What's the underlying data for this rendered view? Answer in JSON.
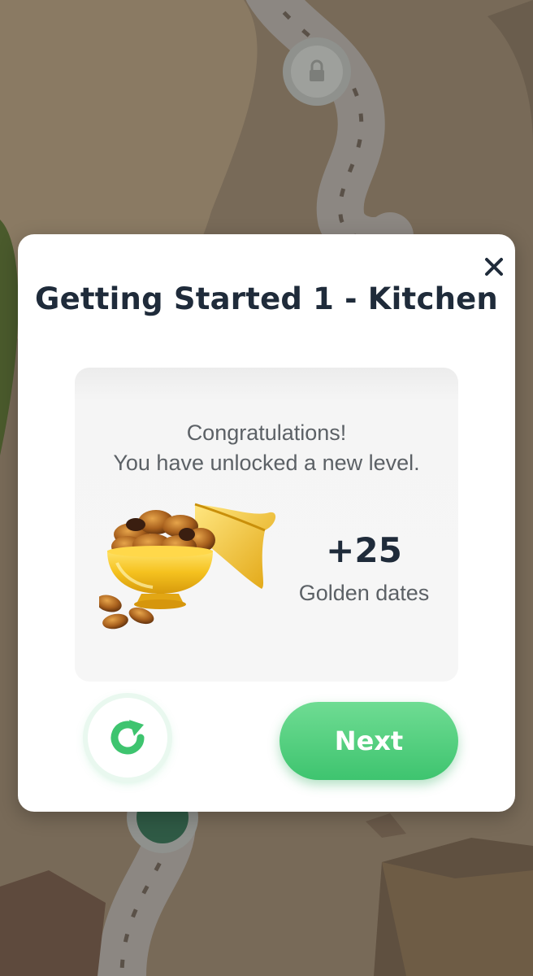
{
  "modal": {
    "title": "Getting Started 1 - Kitchen",
    "close_icon": "close-icon",
    "message_line1": "Congratulations!",
    "message_line2": "You have unlocked a new level.",
    "reward_amount": "+25",
    "reward_label": "Golden dates",
    "reward_icon": "golden-dates-bowl-icon",
    "replay_icon": "replay-icon",
    "next_label": "Next"
  },
  "colors": {
    "title": "#1f2b3a",
    "body_text": "#5c6166",
    "accent_green": "#3ec46f",
    "card_background": "#f6f6f6",
    "backdrop": "#6f6456"
  }
}
